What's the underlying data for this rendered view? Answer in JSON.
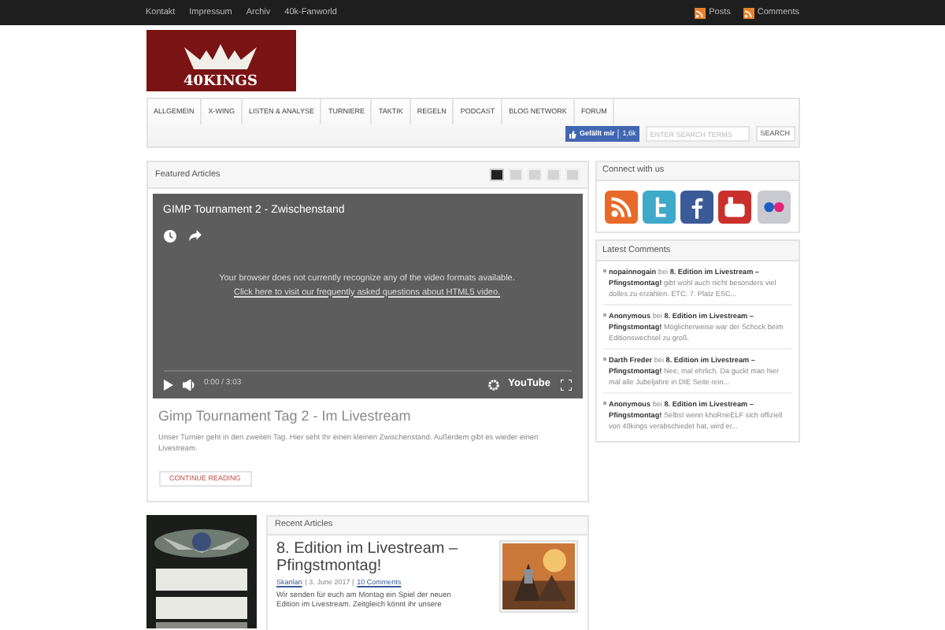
{
  "top_links": [
    "Kontakt",
    "Impressum",
    "Archiv",
    "40k-Fanworld"
  ],
  "feeds": [
    "Posts",
    "Comments"
  ],
  "logo": {
    "text": "40KINGS"
  },
  "nav": [
    "ALLGEMEIN",
    "X-WING",
    "LISTEN & ANALYSE",
    "TURNIERE",
    "TAKTIK",
    "REGELN",
    "PODCAST",
    "BLOG NETWORK",
    "FORUM"
  ],
  "like": {
    "label": "Gefällt mir",
    "count": "1,6k"
  },
  "search": {
    "placeholder": "ENTER SEARCH TERMS",
    "button": "SEARCH"
  },
  "featured": {
    "title": "Featured Articles",
    "thumbs": [
      {
        "selected": true
      },
      {
        "selected": false
      },
      {
        "selected": false
      },
      {
        "selected": false
      },
      {
        "selected": false
      }
    ],
    "video": {
      "title": "GIMP Tournament 2 - Zwischenstand",
      "message": "Your browser does not currently recognize any of the video formats available.",
      "link": "Click here to visit our frequently asked questions about HTML5 video.",
      "time": "0:00 / 3:03",
      "brand": "YouTube"
    },
    "article_title": "Gimp Tournament Tag 2 - Im Livestream",
    "excerpt": "Unser Turnier geht in den zweiten Tag. Hier seht Ihr einen kleinen Zwischenstand. Außerdem gibt es wieder einen Livestream.",
    "button": "CONTINUE READING"
  },
  "recent": {
    "title": "Recent Articles",
    "article_title": "8. Edition im Livestream – Pfingstmontag!",
    "author": "Skanlan",
    "date": "| 3. June 2017 |",
    "comments": "10 Comments",
    "excerpt": "Wir senden für euch am Montag ein Spiel der neuen Edition im Livestream. Zeitgleich könnt ihr unsere"
  },
  "connect": {
    "title": "Connect with us"
  },
  "latest_comments": {
    "title": "Latest Comments",
    "items": [
      "**nopainnogain** bei **8. Edition im Livestream – Pfingstmontag!** gibt wohl auch nicht besonders viel dolles zu erzählen. ETC: 7. Platz ESC...",
      "**Anonymous** bei **8. Edition im Livestream – Pfingstmontag!** Möglicherweise war der Schock beim Editionswechsel zu groß.",
      "**Darth Freder** bei **8. Edition im Livestream – Pfingstmontag!** Nee, mal ehrlich. Da guckt man hier mal alle Jubeljahre in DIE Seite rein...",
      "**Anonymous** bei **8. Edition im Livestream – Pfingstmontag!** Selbst wenn khoRneELF sich offiziell von 40kings verabschiedet hat, wird er..."
    ]
  }
}
